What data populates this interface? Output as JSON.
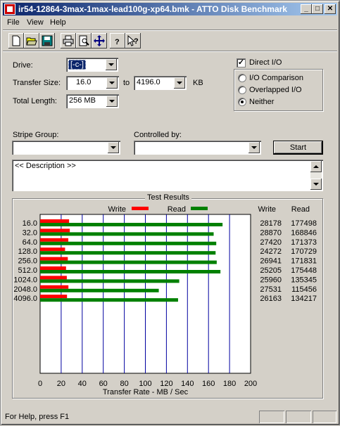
{
  "window": {
    "title": "ir54-12864-3max-1max-lead100g-xp64.bmk - ATTO Disk Benchmark"
  },
  "menu": {
    "items": [
      "File",
      "View",
      "Help"
    ]
  },
  "toolbar": {
    "buttons": [
      "new-icon",
      "open-icon",
      "save-icon",
      "print-icon",
      "print-preview-icon",
      "move-icon",
      "help-icon",
      "context-help-icon"
    ]
  },
  "form": {
    "drive_label": "Drive:",
    "drive_value": "[-c-]",
    "transfer_size_label": "Transfer Size:",
    "transfer_from": "16.0",
    "to_label": "to",
    "transfer_to": "4196.0",
    "kb_label": "KB",
    "total_length_label": "Total Length:",
    "total_length": "256 MB",
    "direct_io_label": "Direct I/O",
    "direct_io_checked": true,
    "io_comparison_label": "I/O Comparison",
    "overlapped_io_label": "Overlapped I/O",
    "neither_label": "Neither",
    "selected_mode": "Neither",
    "stripe_group_label": "Stripe Group:",
    "stripe_group_value": "",
    "controlled_by_label": "Controlled by:",
    "controlled_by_value": "",
    "start_label": "Start",
    "description": "<< Description >>"
  },
  "results": {
    "group_title": "Test Results",
    "write_header": "Write",
    "read_header": "Read"
  },
  "chart_data": {
    "type": "bar",
    "orientation": "horizontal",
    "categories": [
      "16.0",
      "32.0",
      "64.0",
      "128.0",
      "256.0",
      "512.0",
      "1024.0",
      "2048.0",
      "4096.0"
    ],
    "series": [
      {
        "name": "Write",
        "color": "#ff0000",
        "values": [
          28178,
          28870,
          27420,
          24272,
          26941,
          25205,
          25960,
          27531,
          26163
        ]
      },
      {
        "name": "Read",
        "color": "#008000",
        "values": [
          177498,
          168846,
          171373,
          170729,
          171831,
          175448,
          135345,
          115456,
          134217
        ]
      }
    ],
    "xlabel": "Transfer Rate - MB / Sec",
    "xlim": [
      0,
      200
    ],
    "xticks": [
      "0",
      "20",
      "40",
      "60",
      "80",
      "100",
      "120",
      "140",
      "160",
      "180",
      "200"
    ],
    "grid": true,
    "legend": "top"
  },
  "status": {
    "text": "For Help, press F1"
  }
}
